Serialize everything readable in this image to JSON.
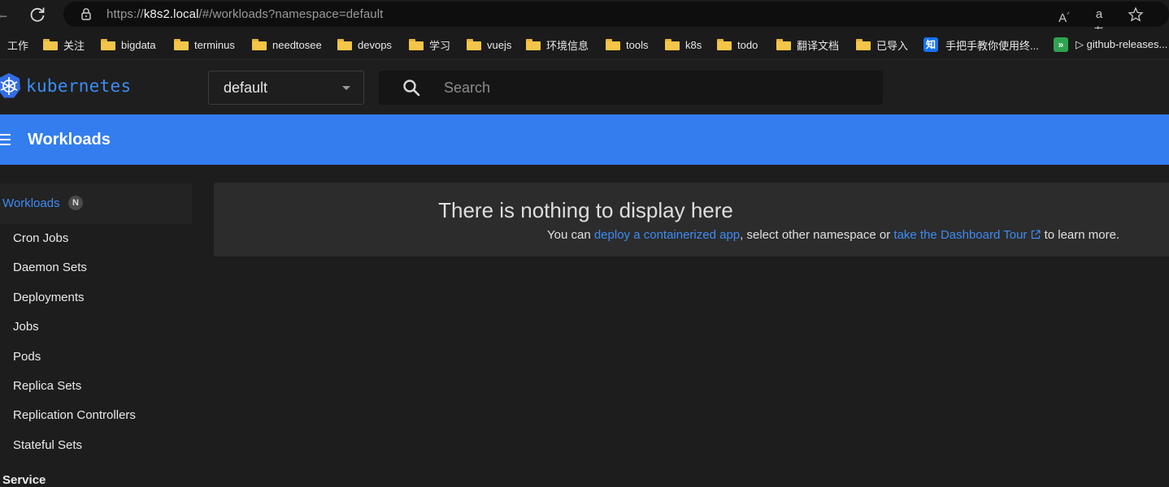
{
  "browser": {
    "url_prefix": "https://",
    "url_host": "k8s2.local",
    "url_path": "/#/workloads?namespace=default",
    "read_aloud_icon": "read-aloud-icon",
    "translate_icon": "translate-icon",
    "favorite_icon": "star-icon"
  },
  "bookmarks": [
    {
      "label": "工作",
      "icon": "none"
    },
    {
      "label": "关注",
      "icon": "folder-icon"
    },
    {
      "label": "bigdata",
      "icon": "folder-icon"
    },
    {
      "label": "terminus",
      "icon": "folder-icon"
    },
    {
      "label": "needtosee",
      "icon": "folder-icon"
    },
    {
      "label": "devops",
      "icon": "folder-icon"
    },
    {
      "label": "学习",
      "icon": "folder-icon"
    },
    {
      "label": "vuejs",
      "icon": "folder-icon"
    },
    {
      "label": "环境信息",
      "icon": "folder-icon"
    },
    {
      "label": "tools",
      "icon": "folder-icon"
    },
    {
      "label": "k8s",
      "icon": "folder-icon"
    },
    {
      "label": "todo",
      "icon": "folder-icon"
    },
    {
      "label": "翻译文档",
      "icon": "folder-icon"
    },
    {
      "label": "已导入",
      "icon": "folder-icon"
    },
    {
      "label": "手把手教你使用终...",
      "icon": "zhihu-icon",
      "icon_text": "知"
    },
    {
      "label": "▷ github-releases...",
      "icon": "github-releases-icon",
      "icon_text": "»"
    }
  ],
  "header": {
    "logo_text": "kubernetes",
    "namespace": "default",
    "search_placeholder": "Search"
  },
  "toolbar": {
    "title": "Workloads"
  },
  "sidebar": {
    "header": {
      "label": "Workloads",
      "badge": "N"
    },
    "items": [
      {
        "label": "Cron Jobs"
      },
      {
        "label": "Daemon Sets"
      },
      {
        "label": "Deployments"
      },
      {
        "label": "Jobs"
      },
      {
        "label": "Pods"
      },
      {
        "label": "Replica Sets"
      },
      {
        "label": "Replication Controllers"
      },
      {
        "label": "Stateful Sets"
      }
    ],
    "next_section": "Service"
  },
  "empty_state": {
    "title": "There is nothing to display here",
    "text_1": "You can ",
    "link_1": "deploy a containerized app",
    "text_2": ", select other namespace or ",
    "link_2": "take the Dashboard Tour",
    "text_3": " to learn more."
  },
  "colors": {
    "accent": "#337def",
    "link": "#3d8cf4",
    "background": "#1d1d1d",
    "card": "#2c2c2c"
  }
}
